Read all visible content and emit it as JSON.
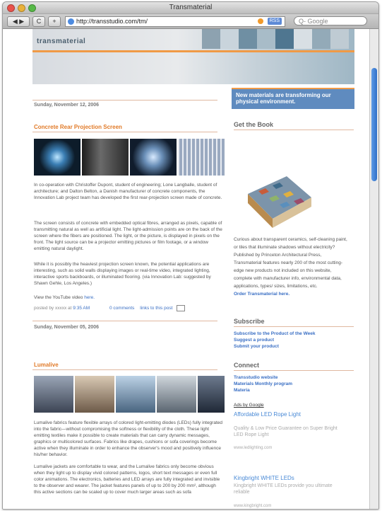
{
  "window": {
    "title": "Transmaterial"
  },
  "toolbar": {
    "back": "◀ ▶",
    "reload": "C",
    "add": "+",
    "url": "http://transstudio.com/tm/",
    "rss": "RSS",
    "search_placeholder": "Q- Google"
  },
  "header": {
    "logo": "transmaterial",
    "tagline": "New materials are transforming our physical environment."
  },
  "posts": [
    {
      "date": "Sunday, November 12, 2006",
      "title": "Concrete Rear Projection Screen",
      "paragraphs": [
        "In co-operation with Christoffer Dupont, student of engineering; Lone Langballe, student of architecture; and Dalton Belton, a Danish manufacturer of concrete components, the Innovation Lab project team has developed the first rear-projection screen made of concrete.",
        "The screen consists of concrete with embedded optical fibres, arranged as pixels, capable of transmitting natural as well as artificial light. The light-admission points are on the back of the screen where the fibers are positioned. The light, or the picture, is displayed in pixels on the front. The light source can be a projector emitting pictures or film footage, or a window emitting natural daylight.",
        "While it is possibly the heaviest projection screen known, the potential applications are interesting, such as solid walls displaying images or real-time video, integrated lighting, interactive sports backboards, or illuminated flooring. (via Innovation Lab: suggested by Shawn Gehle, Los Angeles.)"
      ],
      "video_text": "View the YouTube video",
      "video_link": "here.",
      "posted_by": "posted by xxxxx at",
      "time": "9:35 AM",
      "comments": "0 comments",
      "links": "links to this post"
    },
    {
      "date": "Sunday, November 05, 2006",
      "title": "Lumalive",
      "paragraphs": [
        "Lumalive fabrics feature flexible arrays of colored light-emitting diodes (LEDs) fully integrated into the fabric—without compromising the softness or flexibility of the cloth. These light emitting textiles make it possible to create materials that can carry dynamic messages, graphics or multicolored surfaces. Fabrics like drapes, cushions or sofa coverings become active when they illuminate in order to enhance the observer's mood and positively influence his/her behavior.",
        "Lumalive jackets are comfortable to wear, and the Lumalive fabrics only become obvious when they light up to display vivid colored patterns, logos, short text messages or even full color animations. The electronics, batteries and LED arrays are fully integrated and invisible to the observer and wearer. The jacket features panels of up to 200 by 200 mm², although this active sections can be scaled up to cover much larger areas such as sofa"
      ]
    }
  ],
  "sidebar": {
    "book_heading": "Get the Book",
    "book_text": [
      "Curious about transparent ceramics, self-cleaning paint,",
      "or tiles that illuminate shadows without electricity?",
      "Published by Princeton Architectural Press,",
      "Transmaterial features nearly 200 of the most cutting-",
      "edge new products not included on this website,",
      "complete with manufacturer info, environmental data,",
      "applications, types/ sizes, limitations, etc."
    ],
    "book_link": "Order Transmaterial here.",
    "subscribe_heading": "Subscribe",
    "subscribe_links": [
      "Subscribe to the Product of the Week",
      "Suggest a product",
      "Submit your product"
    ],
    "connect_heading": "Connect",
    "connect_links": [
      "Transstudio website",
      "Materials Monthly program",
      "Materia"
    ],
    "ads_label": "Ads by Google",
    "ads": [
      {
        "title": "Affordable LED Rope Light",
        "text": "Quality & Low Price Guarantee on Super Bright LED Rope Light",
        "url": "www.ledlighting.com"
      },
      {
        "title": "Kingbright WHITE LEDs",
        "text": "Kingbright WHITE LEDs provide you ultimate reliable",
        "url": "www.kingbright.com"
      }
    ]
  },
  "colors": {
    "accent": "#e17a28",
    "link": "#3a6fc4",
    "banner_blue": "#5f8bbf"
  }
}
